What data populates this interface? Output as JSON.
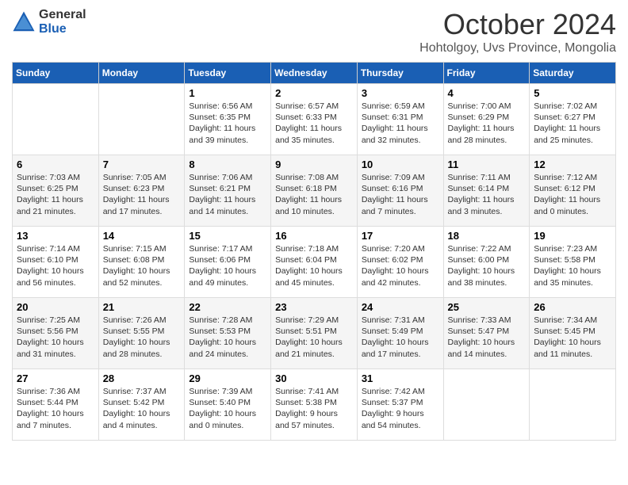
{
  "header": {
    "logo_general": "General",
    "logo_blue": "Blue",
    "month_title": "October 2024",
    "location": "Hohtolgoy, Uvs Province, Mongolia"
  },
  "days_header": [
    "Sunday",
    "Monday",
    "Tuesday",
    "Wednesday",
    "Thursday",
    "Friday",
    "Saturday"
  ],
  "weeks": [
    [
      {
        "day": "",
        "text": ""
      },
      {
        "day": "",
        "text": ""
      },
      {
        "day": "1",
        "text": "Sunrise: 6:56 AM\nSunset: 6:35 PM\nDaylight: 11 hours and 39 minutes."
      },
      {
        "day": "2",
        "text": "Sunrise: 6:57 AM\nSunset: 6:33 PM\nDaylight: 11 hours and 35 minutes."
      },
      {
        "day": "3",
        "text": "Sunrise: 6:59 AM\nSunset: 6:31 PM\nDaylight: 11 hours and 32 minutes."
      },
      {
        "day": "4",
        "text": "Sunrise: 7:00 AM\nSunset: 6:29 PM\nDaylight: 11 hours and 28 minutes."
      },
      {
        "day": "5",
        "text": "Sunrise: 7:02 AM\nSunset: 6:27 PM\nDaylight: 11 hours and 25 minutes."
      }
    ],
    [
      {
        "day": "6",
        "text": "Sunrise: 7:03 AM\nSunset: 6:25 PM\nDaylight: 11 hours and 21 minutes."
      },
      {
        "day": "7",
        "text": "Sunrise: 7:05 AM\nSunset: 6:23 PM\nDaylight: 11 hours and 17 minutes."
      },
      {
        "day": "8",
        "text": "Sunrise: 7:06 AM\nSunset: 6:21 PM\nDaylight: 11 hours and 14 minutes."
      },
      {
        "day": "9",
        "text": "Sunrise: 7:08 AM\nSunset: 6:18 PM\nDaylight: 11 hours and 10 minutes."
      },
      {
        "day": "10",
        "text": "Sunrise: 7:09 AM\nSunset: 6:16 PM\nDaylight: 11 hours and 7 minutes."
      },
      {
        "day": "11",
        "text": "Sunrise: 7:11 AM\nSunset: 6:14 PM\nDaylight: 11 hours and 3 minutes."
      },
      {
        "day": "12",
        "text": "Sunrise: 7:12 AM\nSunset: 6:12 PM\nDaylight: 11 hours and 0 minutes."
      }
    ],
    [
      {
        "day": "13",
        "text": "Sunrise: 7:14 AM\nSunset: 6:10 PM\nDaylight: 10 hours and 56 minutes."
      },
      {
        "day": "14",
        "text": "Sunrise: 7:15 AM\nSunset: 6:08 PM\nDaylight: 10 hours and 52 minutes."
      },
      {
        "day": "15",
        "text": "Sunrise: 7:17 AM\nSunset: 6:06 PM\nDaylight: 10 hours and 49 minutes."
      },
      {
        "day": "16",
        "text": "Sunrise: 7:18 AM\nSunset: 6:04 PM\nDaylight: 10 hours and 45 minutes."
      },
      {
        "day": "17",
        "text": "Sunrise: 7:20 AM\nSunset: 6:02 PM\nDaylight: 10 hours and 42 minutes."
      },
      {
        "day": "18",
        "text": "Sunrise: 7:22 AM\nSunset: 6:00 PM\nDaylight: 10 hours and 38 minutes."
      },
      {
        "day": "19",
        "text": "Sunrise: 7:23 AM\nSunset: 5:58 PM\nDaylight: 10 hours and 35 minutes."
      }
    ],
    [
      {
        "day": "20",
        "text": "Sunrise: 7:25 AM\nSunset: 5:56 PM\nDaylight: 10 hours and 31 minutes."
      },
      {
        "day": "21",
        "text": "Sunrise: 7:26 AM\nSunset: 5:55 PM\nDaylight: 10 hours and 28 minutes."
      },
      {
        "day": "22",
        "text": "Sunrise: 7:28 AM\nSunset: 5:53 PM\nDaylight: 10 hours and 24 minutes."
      },
      {
        "day": "23",
        "text": "Sunrise: 7:29 AM\nSunset: 5:51 PM\nDaylight: 10 hours and 21 minutes."
      },
      {
        "day": "24",
        "text": "Sunrise: 7:31 AM\nSunset: 5:49 PM\nDaylight: 10 hours and 17 minutes."
      },
      {
        "day": "25",
        "text": "Sunrise: 7:33 AM\nSunset: 5:47 PM\nDaylight: 10 hours and 14 minutes."
      },
      {
        "day": "26",
        "text": "Sunrise: 7:34 AM\nSunset: 5:45 PM\nDaylight: 10 hours and 11 minutes."
      }
    ],
    [
      {
        "day": "27",
        "text": "Sunrise: 7:36 AM\nSunset: 5:44 PM\nDaylight: 10 hours and 7 minutes."
      },
      {
        "day": "28",
        "text": "Sunrise: 7:37 AM\nSunset: 5:42 PM\nDaylight: 10 hours and 4 minutes."
      },
      {
        "day": "29",
        "text": "Sunrise: 7:39 AM\nSunset: 5:40 PM\nDaylight: 10 hours and 0 minutes."
      },
      {
        "day": "30",
        "text": "Sunrise: 7:41 AM\nSunset: 5:38 PM\nDaylight: 9 hours and 57 minutes."
      },
      {
        "day": "31",
        "text": "Sunrise: 7:42 AM\nSunset: 5:37 PM\nDaylight: 9 hours and 54 minutes."
      },
      {
        "day": "",
        "text": ""
      },
      {
        "day": "",
        "text": ""
      }
    ]
  ]
}
